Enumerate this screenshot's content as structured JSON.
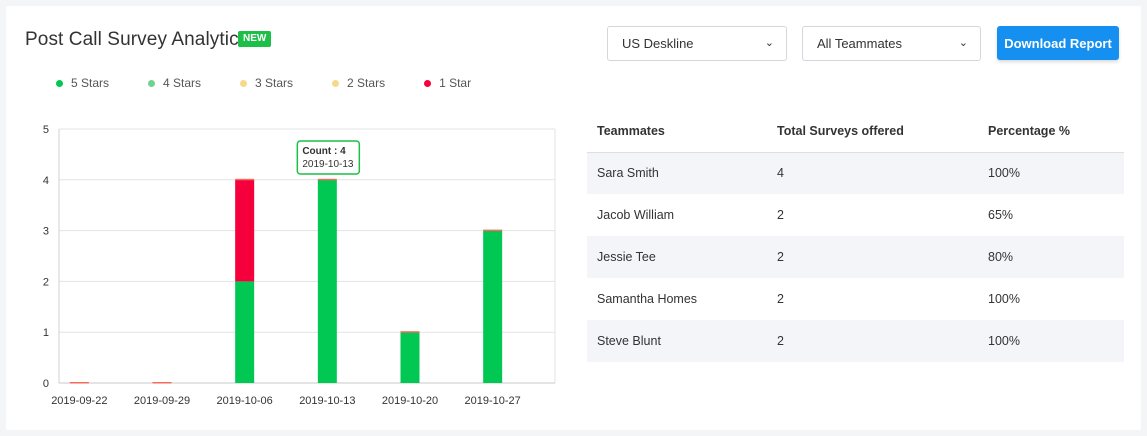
{
  "header": {
    "title": "Post Call Survey Analytics",
    "badge": "NEW"
  },
  "filters": {
    "team": {
      "value": "US Deskline"
    },
    "teammates": {
      "value": "All Teammates"
    }
  },
  "actions": {
    "download_label": "Download Report"
  },
  "legend": [
    {
      "label": "5 Stars",
      "color": "#00c853"
    },
    {
      "label": "4 Stars",
      "color": "#6fd38f"
    },
    {
      "label": "3 Stars",
      "color": "#f6d98b"
    },
    {
      "label": "2 Stars",
      "color": "#f6d98b"
    },
    {
      "label": "1 Star",
      "color": "#f5003d"
    }
  ],
  "tooltip": {
    "line1": "Count : 4",
    "line2": "2019-10-13"
  },
  "chart_data": {
    "type": "bar",
    "stacked": true,
    "categories": [
      "2019-09-22",
      "2019-09-29",
      "2019-10-06",
      "2019-10-13",
      "2019-10-20",
      "2019-10-27"
    ],
    "series": [
      {
        "name": "5 Stars",
        "color": "#00c853",
        "values": [
          0,
          0,
          2,
          4,
          1,
          3
        ]
      },
      {
        "name": "4 Stars",
        "color": "#6fd38f",
        "values": [
          0,
          0,
          0,
          0,
          0,
          0
        ]
      },
      {
        "name": "3 Stars",
        "color": "#f6d98b",
        "values": [
          0,
          0,
          0,
          0,
          0,
          0
        ]
      },
      {
        "name": "2 Stars",
        "color": "#f6d98b",
        "values": [
          0,
          0,
          0,
          0,
          0,
          0
        ]
      },
      {
        "name": "1 Star",
        "color": "#f5003d",
        "values": [
          0,
          0,
          2,
          0,
          0,
          0
        ]
      }
    ],
    "yticks": [
      "0",
      "1",
      "2",
      "3",
      "4",
      "5"
    ],
    "ylim": [
      0,
      5
    ],
    "grid": true,
    "legend_position": "top-left"
  },
  "table": {
    "headers": [
      "Teammates",
      "Total Surveys offered",
      "Percentage %"
    ],
    "rows": [
      [
        "Sara Smith",
        "4",
        "100%"
      ],
      [
        "Jacob William",
        "2",
        "65%"
      ],
      [
        "Jessie Tee",
        "2",
        "80%"
      ],
      [
        "Samantha Homes",
        "2",
        "100%"
      ],
      [
        "Steve Blunt",
        "2",
        "100%"
      ]
    ]
  }
}
